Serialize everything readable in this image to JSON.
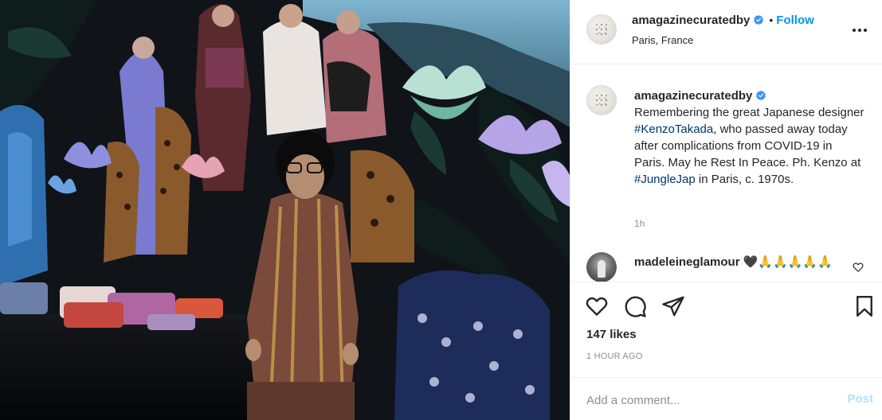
{
  "post": {
    "username": "amagazinecuratedby",
    "verified": true,
    "follow_label": "Follow",
    "separator": "•",
    "location": "Paris, France",
    "more_icon": "more-options-icon"
  },
  "caption": {
    "username": "amagazinecuratedby",
    "text_before": "Remembering the great Japanese designer ",
    "hashtag1": "#KenzoTakada",
    "text_middle": ", who passed away today after complications from COVID-19 in Paris. May he Rest In Peace. Ph. Kenzo at ",
    "hashtag2": "#JungleJap",
    "text_after": " in Paris, c. 1970s.",
    "time": "1h"
  },
  "comments": [
    {
      "username": "madeleineglamour",
      "text": "🖤🙏🙏🙏🙏🙏"
    }
  ],
  "actions": {
    "like_icon": "heart-icon",
    "comment_icon": "comment-icon",
    "share_icon": "share-icon",
    "save_icon": "bookmark-icon"
  },
  "likes": "147 likes",
  "time_ago": "1 HOUR AGO",
  "add_comment": {
    "placeholder": "Add a comment...",
    "post_label": "Post"
  },
  "colors": {
    "link_blue": "#0095f6",
    "hashtag_blue": "#00376b",
    "muted": "#8e8e8e",
    "border": "#efefef"
  }
}
